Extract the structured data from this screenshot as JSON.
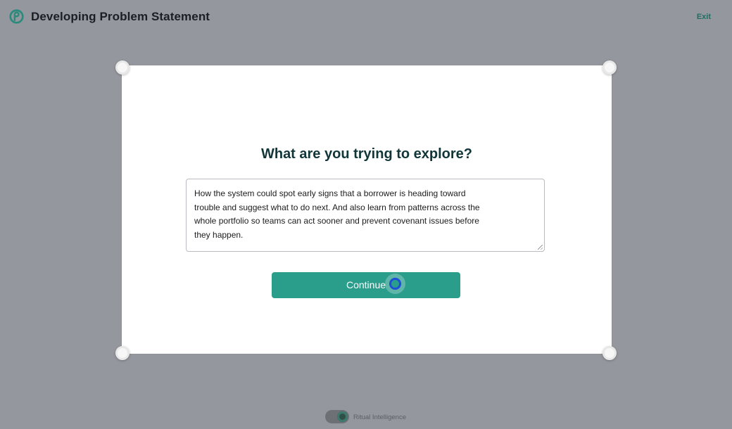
{
  "header": {
    "title": "Developing Problem Statement",
    "exit_label": "Exit"
  },
  "card": {
    "question": "What are you trying to explore?",
    "answer": "How the system could spot early signs that a borrower is heading toward trouble and suggest what to do next. And also learn from patterns across the whole portfolio so teams can act sooner and prevent covenant issues before they happen.",
    "continue_label": "Continue"
  },
  "footer": {
    "toggle_label": "Ritual Intelligence",
    "toggle_on": true
  },
  "colors": {
    "backdrop": "#94979d",
    "accent": "#2a9d8b",
    "heading": "#10363a",
    "cursor": "#1f4fd8"
  },
  "icons": {
    "logo": "ritual-logo-icon"
  }
}
